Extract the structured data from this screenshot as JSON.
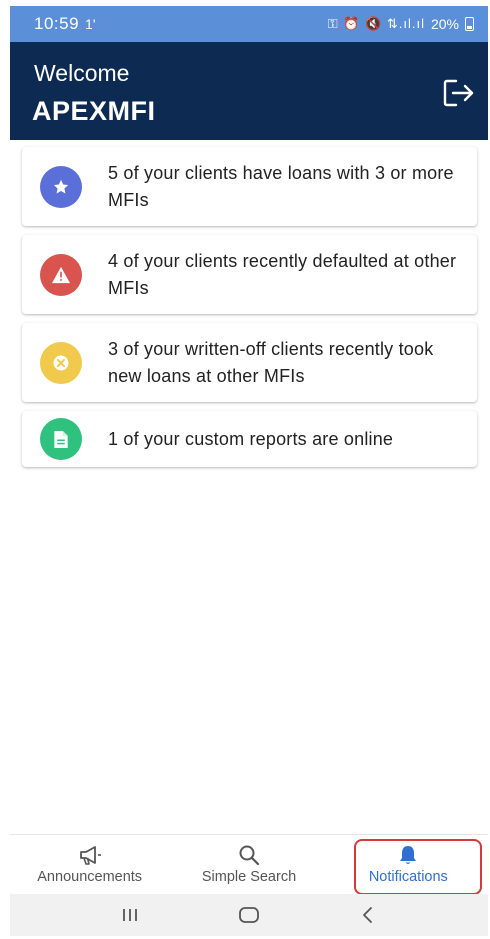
{
  "status_bar": {
    "time": "10:59",
    "extra": "1'",
    "icons": "⚿ ⏰ 🔇 ⇅.ıl.ıl",
    "battery": "20%"
  },
  "header": {
    "welcome": "Welcome",
    "org_name": "APEXMFI"
  },
  "notifications": [
    {
      "text": "5 of your clients have loans with 3 or more MFIs",
      "icon": "star-icon",
      "color": "#5a6fd8"
    },
    {
      "text": "4 of your clients recently defaulted at other MFIs",
      "icon": "warning-icon",
      "color": "#d9534f"
    },
    {
      "text": "3 of your written-off clients recently took new loans at other MFIs",
      "icon": "cancel-icon",
      "color": "#f0c94d"
    },
    {
      "text": "1 of your custom reports are online",
      "icon": "document-icon",
      "color": "#2ec27e"
    }
  ],
  "bottom_nav": {
    "announcements": "Announcements",
    "simple_search": "Simple Search",
    "notifications": "Notifications",
    "active": "Notifications",
    "active_color": "#2f6fd1"
  }
}
